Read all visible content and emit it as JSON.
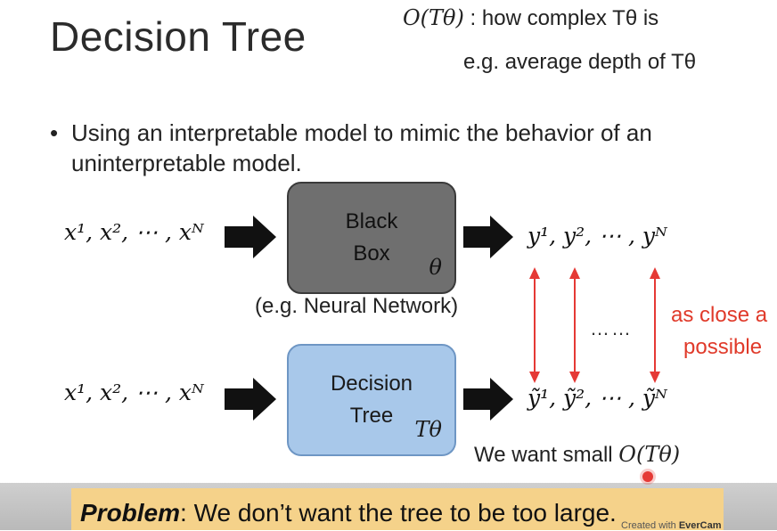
{
  "slide": {
    "title": "Decision Tree",
    "top_note": {
      "line1_math": "O(Tθ)",
      "line1_text": ": how complex Tθ is",
      "line2_text": "e.g. average depth of Tθ"
    },
    "bullet": "Using an interpretable model to mimic the behavior of an uninterpretable model.",
    "inputs_top": "x¹, x², ⋯ , xᴺ",
    "inputs_bottom": "x¹, x², ⋯ , xᴺ",
    "black_box": {
      "line1": "Black",
      "line2": "Box",
      "symbol": "θ",
      "caption": "(e.g. Neural Network)"
    },
    "decision_tree": {
      "line1": "Decision",
      "line2": "Tree",
      "symbol": "Tθ"
    },
    "outputs_top": "y¹, y², ⋯ , yᴺ",
    "outputs_bottom": "ỹ¹, ỹ², ⋯ , ỹᴺ",
    "dots": "……",
    "close_text": {
      "line1": "as close a",
      "line2": "possible"
    },
    "want_text": "We want small",
    "want_math": "O(Tθ)",
    "problem_label": "Problem",
    "problem_text": ": We don’t want the tree to be too large."
  },
  "overlay": {
    "watermark_prefix": "Created with",
    "watermark_brand": "EverCam"
  },
  "colors": {
    "arrow_black": "#111111",
    "arrow_red": "#e53935",
    "black_box_fill": "#6f6f6f",
    "tree_box_fill": "#a8c8ea",
    "problem_fill": "#f5d28a",
    "close_text": "#e03a2a"
  }
}
